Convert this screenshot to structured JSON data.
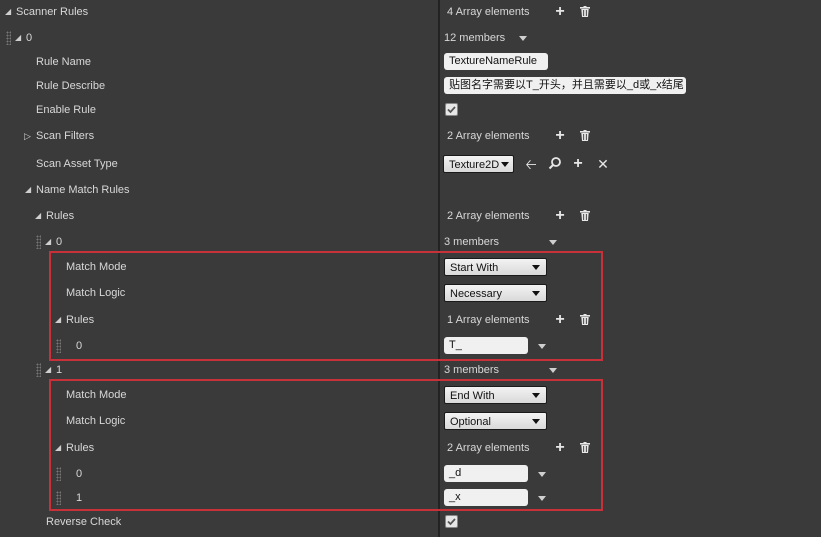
{
  "header": {
    "title": "Scanner Rules",
    "summary": "4 Array elements"
  },
  "item0": {
    "index": "0",
    "summary": "12 members",
    "rule_name": {
      "label": "Rule Name",
      "value": "TextureNameRule"
    },
    "rule_describe": {
      "label": "Rule Describe",
      "value": "贴图名字需要以T_开头，并且需要以_d或_x结尾"
    },
    "enable_rule": {
      "label": "Enable Rule",
      "checked": true
    },
    "scan_filters": {
      "label": "Scan Filters",
      "summary": "2 Array elements"
    },
    "scan_asset_type": {
      "label": "Scan Asset Type",
      "value": "Texture2D"
    },
    "name_match_rules": {
      "label": "Name Match Rules",
      "rules_label": "Rules",
      "rules_summary": "2 Array elements",
      "entries": [
        {
          "index": "0",
          "summary": "3 members",
          "match_mode_label": "Match Mode",
          "match_mode": "Start With",
          "match_logic_label": "Match Logic",
          "match_logic": "Necessary",
          "rules_label": "Rules",
          "rules_summary": "1 Array elements",
          "values": [
            {
              "index": "0",
              "value": "T_"
            }
          ]
        },
        {
          "index": "1",
          "summary": "3 members",
          "match_mode_label": "Match Mode",
          "match_mode": "End With",
          "match_logic_label": "Match Logic",
          "match_logic": "Optional",
          "rules_label": "Rules",
          "rules_summary": "2 Array elements",
          "values": [
            {
              "index": "0",
              "value": "_d"
            },
            {
              "index": "1",
              "value": "_x"
            }
          ]
        }
      ]
    },
    "reverse_check": {
      "label": "Reverse Check",
      "checked": true
    }
  },
  "colors": {
    "background": "#3a3a3a",
    "highlight_box": "#c8303a",
    "text": "#d8d8d8"
  },
  "icons": [
    "add-icon",
    "delete-icon",
    "use-selected-icon",
    "browse-icon",
    "clear-icon",
    "checkmark-icon",
    "collapse-triangle-icon",
    "expand-triangle-icon",
    "drag-grip-icon",
    "dropdown-arrow-icon"
  ]
}
